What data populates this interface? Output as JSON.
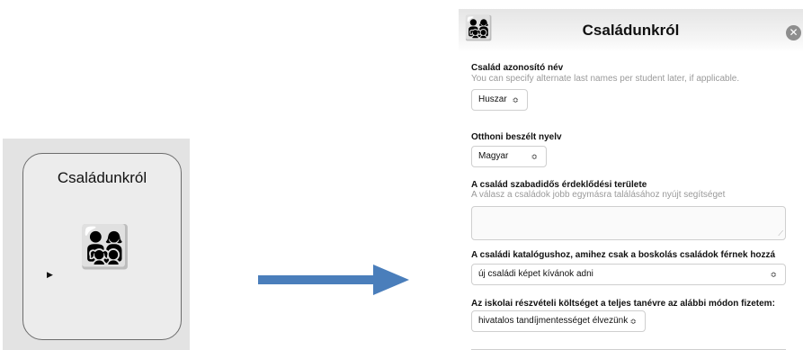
{
  "before": {
    "card_title": "Családunkról",
    "card_emoji": "👨‍👩‍👧‍👦"
  },
  "panel": {
    "title": "Családunkról",
    "header_emoji": "👨‍👩‍👧‍👦",
    "close_glyph": "✕"
  },
  "fields": {
    "family_id": {
      "label": "Család azonosító név",
      "help": "You can specify alternate last names per student later, if applicable.",
      "value": "Huszar"
    },
    "home_language": {
      "label": "Otthoni beszélt nyelv",
      "value": "Magyar"
    },
    "leisure": {
      "label": "A család szabadidős érdeklődési területe",
      "help": "A válasz a családok jobb egymásra találásához nyújt segítséget"
    },
    "catalog": {
      "label": "A családi katalógushoz, amihez csak a boskolás családok férnek hozzá",
      "value": "új családi képet kívánok adni"
    },
    "tuition": {
      "label": "Az iskolai részvételi költséget a teljes tanévre az alábbi módon fizetem:",
      "value": "hivatalos tandíjmentességet élvezünk"
    }
  },
  "icons": {
    "select_chevron": "≎",
    "pointer": "▶",
    "resize_grip": "⟋"
  },
  "colors": {
    "arrow": "#4a7ebb",
    "card_border": "#6c6c6c",
    "close_bg": "#8e8e8e"
  }
}
